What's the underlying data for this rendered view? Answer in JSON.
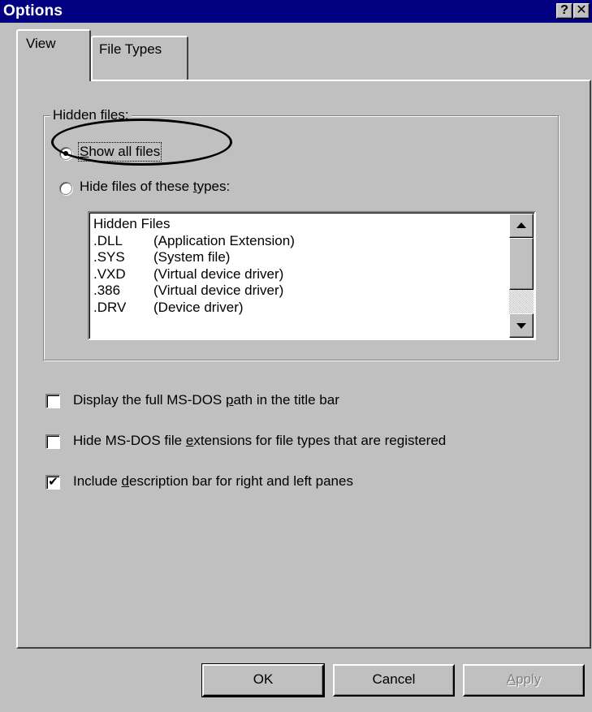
{
  "window": {
    "title": "Options",
    "help_label": "?",
    "close_label": "✕"
  },
  "tabs": [
    {
      "label": "View",
      "active": true
    },
    {
      "label": "File Types",
      "active": false
    }
  ],
  "hidden_files": {
    "group_label": "Hidden files:",
    "option_show_all": {
      "label_pre": "",
      "label_mnemonic": "S",
      "label_post": "how all files",
      "selected": true
    },
    "option_hide_types": {
      "label_pre": "Hide files of these ",
      "label_mnemonic": "t",
      "label_post": "ypes:",
      "selected": false
    },
    "list": [
      {
        "ext": "Hidden Files",
        "desc": ""
      },
      {
        "ext": ".DLL",
        "desc": "(Application Extension)"
      },
      {
        "ext": ".SYS",
        "desc": "(System file)"
      },
      {
        "ext": ".VXD",
        "desc": "(Virtual device driver)"
      },
      {
        "ext": ".386",
        "desc": "(Virtual device driver)"
      },
      {
        "ext": ".DRV",
        "desc": "(Device driver)"
      }
    ]
  },
  "checkboxes": [
    {
      "label_pre": "Display the full MS-DOS ",
      "label_mnemonic": "p",
      "label_post": "ath in the title bar",
      "checked": false,
      "mark": ""
    },
    {
      "label_pre": "Hide MS-DOS file ",
      "label_mnemonic": "e",
      "label_post": "xtensions for file types that are registered",
      "checked": false,
      "mark": ""
    },
    {
      "label_pre": "Include ",
      "label_mnemonic": "d",
      "label_post": "escription bar for right and left panes",
      "checked": true,
      "mark": "✔"
    }
  ],
  "buttons": {
    "ok": "OK",
    "cancel": "Cancel",
    "apply_mnemonic": "A",
    "apply_rest": "pply",
    "apply_enabled": false
  },
  "colors": {
    "titlebar": "#000080",
    "face": "#c0c0c0",
    "disabled_text": "#808080"
  }
}
